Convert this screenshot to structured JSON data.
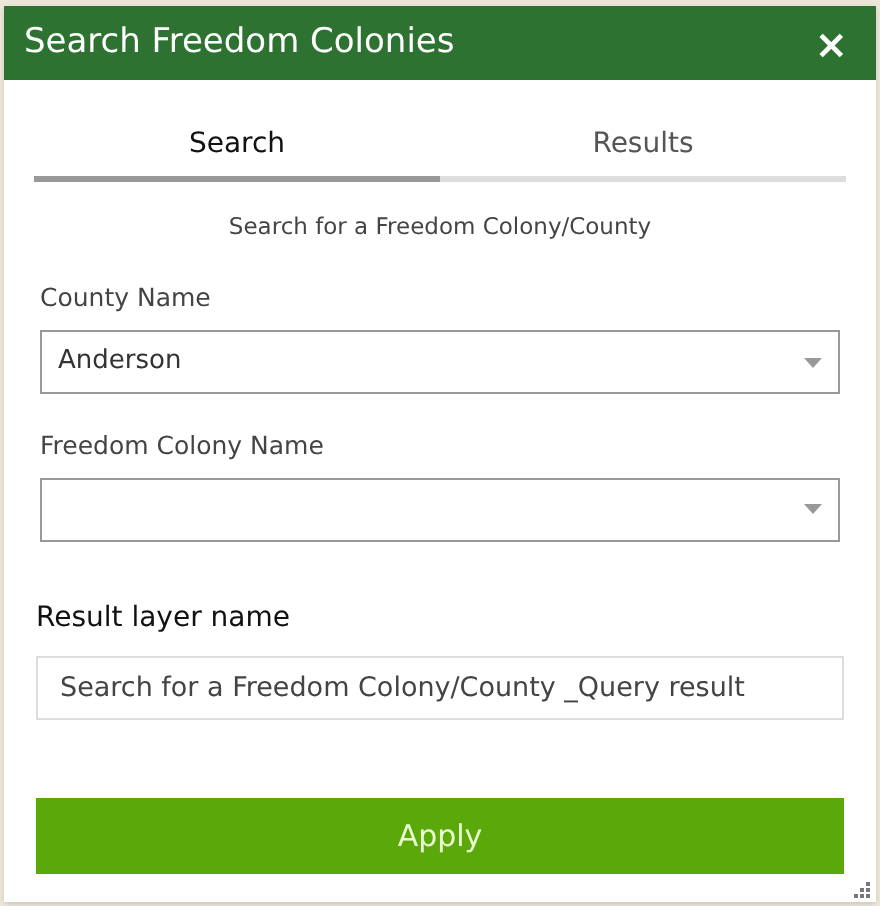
{
  "window": {
    "title": "Search Freedom Colonies",
    "close": "×"
  },
  "tabs": [
    {
      "label": "Search",
      "selected": true
    },
    {
      "label": "Results",
      "selected": false
    }
  ],
  "description": "Search for a Freedom Colony/County",
  "fields": [
    {
      "label": "County Name",
      "value": "Anderson"
    },
    {
      "label": "Freedom Colony Name"
    }
  ],
  "result_layer": {
    "label": "Result layer name",
    "value": "Search for a Freedom Colony/County _Query result"
  },
  "apply_button": "Apply"
}
